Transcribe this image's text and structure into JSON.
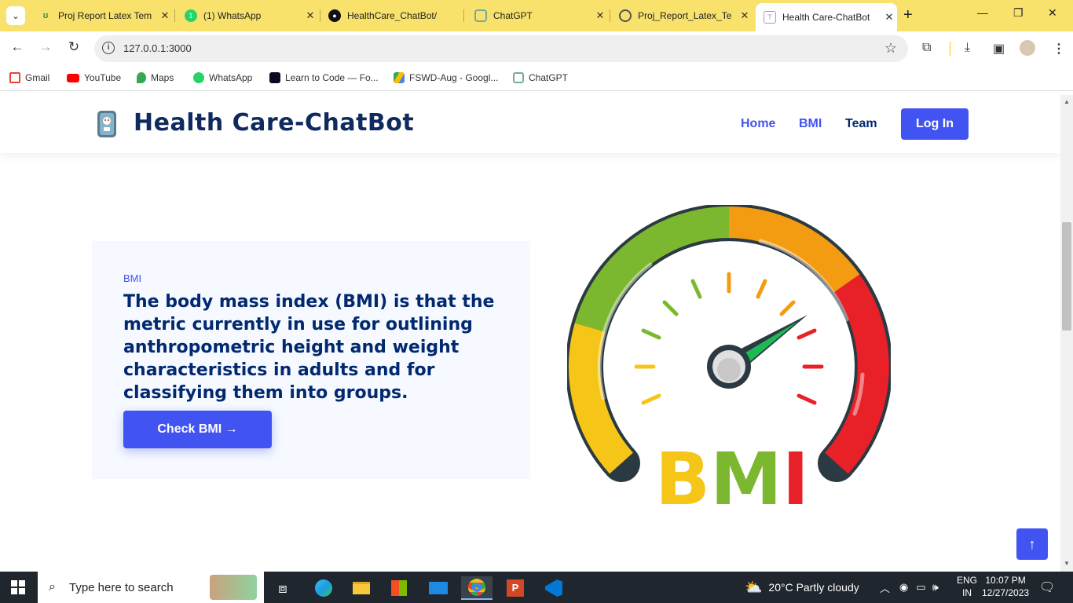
{
  "tabs": [
    {
      "title": "Proj Report Latex Tem",
      "icon": "overleaf-icon",
      "color": "#3d8b37"
    },
    {
      "title": "(1) WhatsApp",
      "icon": "whatsapp-icon",
      "color": "#25d366"
    },
    {
      "title": "HealthCare_ChatBot/",
      "icon": "github-icon",
      "color": "#111111"
    },
    {
      "title": "ChatGPT",
      "icon": "chatgpt-icon",
      "color": "#74aa9c"
    },
    {
      "title": "Proj_Report_Latex_Te",
      "icon": "globe-icon",
      "color": "#555555"
    },
    {
      "title": "Health Care-ChatBot",
      "icon": "page-icon",
      "color": "#b38cd9"
    }
  ],
  "address": {
    "url": "127.0.0.1:3000"
  },
  "bookmarks": [
    {
      "label": "Gmail",
      "color": "#ea4335"
    },
    {
      "label": "YouTube",
      "color": "#ff0000"
    },
    {
      "label": "Maps",
      "color": "#34a853"
    },
    {
      "label": "WhatsApp",
      "color": "#25d366"
    },
    {
      "label": "Learn to Code — Fo...",
      "color": "#0a0a23"
    },
    {
      "label": "FSWD-Aug - Googl...",
      "color": "#fbbc04"
    },
    {
      "label": "ChatGPT",
      "color": "#74aa9c"
    }
  ],
  "site": {
    "brand": "Health Care-ChatBot",
    "nav": {
      "home": "Home",
      "bmi": "BMI",
      "team": "Team",
      "login": "Log In"
    },
    "hero": {
      "tag": "BMI",
      "text": "The body mass index (BMI) is that the metric currently in use for outlining anthropometric height and weight characteristics in adults and for classifying them into groups.",
      "button": "Check BMI →"
    },
    "gauge_label": "BMI",
    "accent": "#4154f1",
    "navy": "#012970"
  },
  "taskbar": {
    "search_placeholder": "Type here to search",
    "weather": "20°C  Partly cloudy",
    "lang": "ENG",
    "region": "IN",
    "time": "10:07 PM",
    "date": "12/27/2023"
  }
}
